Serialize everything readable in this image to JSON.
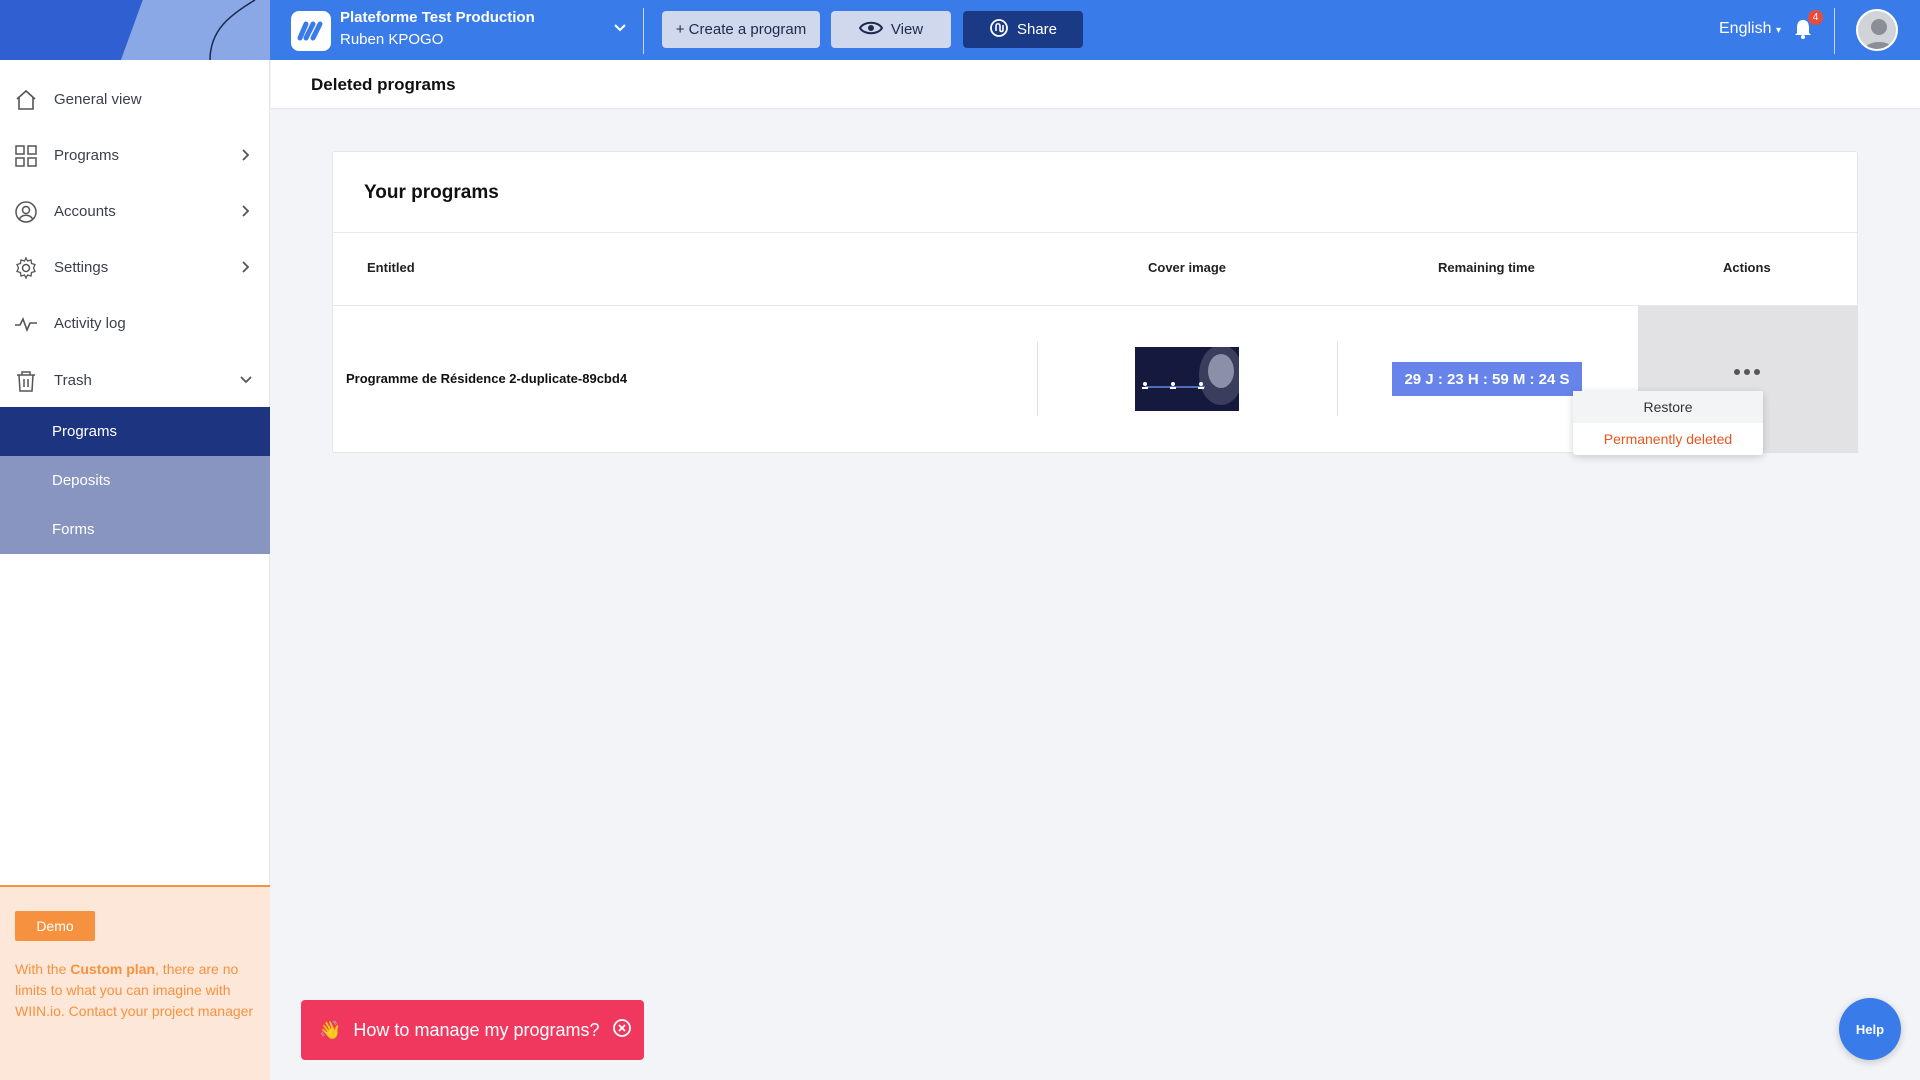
{
  "header": {
    "workspace_title": "Plateforme Test Production",
    "workspace_user": "Ruben KPOGO",
    "create_label": "+ Create a program",
    "view_label": "View",
    "share_label": "Share",
    "language": "English",
    "notification_count": "4"
  },
  "sidebar": {
    "items": [
      {
        "label": "General view",
        "icon": "home-icon"
      },
      {
        "label": "Programs",
        "icon": "grid-icon"
      },
      {
        "label": "Accounts",
        "icon": "user-circle-icon"
      },
      {
        "label": "Settings",
        "icon": "gear-icon"
      },
      {
        "label": "Activity log",
        "icon": "activity-icon"
      },
      {
        "label": "Trash",
        "icon": "trash-icon"
      }
    ],
    "trash_sub": [
      {
        "label": "Programs",
        "active": true
      },
      {
        "label": "Deposits",
        "active": false
      },
      {
        "label": "Forms",
        "active": false
      }
    ],
    "promo": {
      "demo_label": "Demo",
      "text_before": "With the ",
      "text_bold": "Custom plan",
      "text_after": ", there are no limits to what you can imagine with WIIN.io. Contact your project manager"
    }
  },
  "page": {
    "title": "Deleted programs"
  },
  "card": {
    "title": "Your programs",
    "columns": [
      "Entitled",
      "Cover image",
      "Remaining time",
      "Actions"
    ],
    "rows": [
      {
        "name": "Programme de Résidence 2-duplicate-89cbd4",
        "remaining": "29 J : 23 H : 59 M : 24 S"
      }
    ]
  },
  "action_menu": {
    "restore": "Restore",
    "delete": "Permanently deleted"
  },
  "howto": {
    "emoji": "👋",
    "label": "How to manage my programs?"
  },
  "help_label": "Help",
  "colors": {
    "primary": "#3a7bea",
    "dark_navy": "#1d3580",
    "accent_orange": "#f6923f",
    "danger": "#e8561c",
    "pink": "#f0385f"
  }
}
